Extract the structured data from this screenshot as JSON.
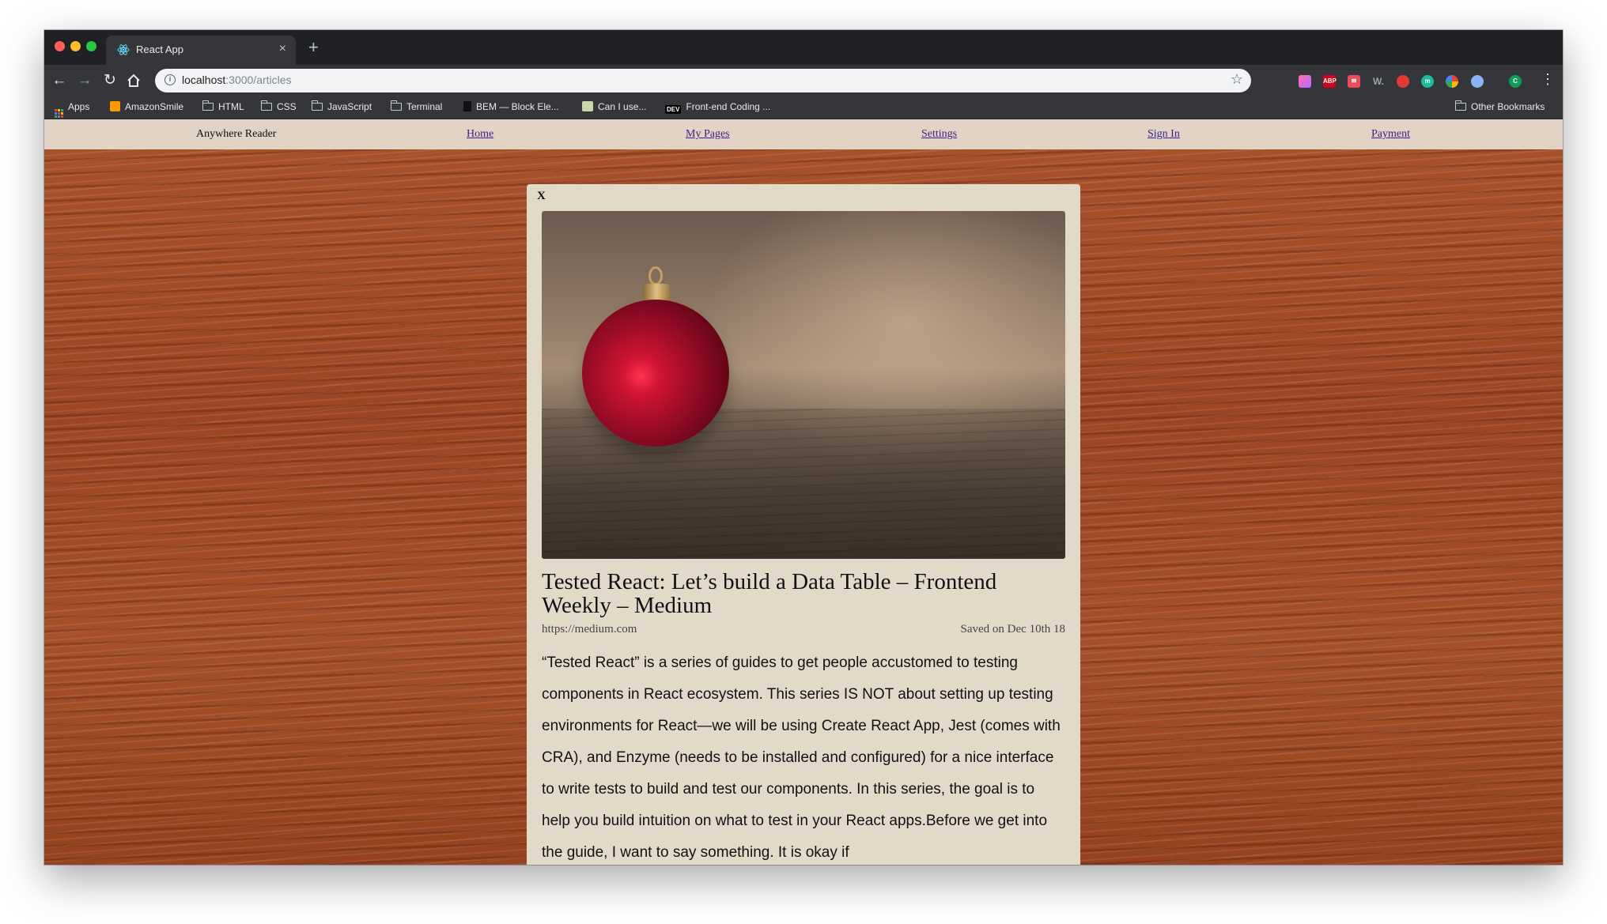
{
  "browser": {
    "tab_title": "React App",
    "tab_close": "×",
    "new_tab": "+",
    "url_host": "localhost",
    "url_path": ":3000/articles",
    "bookmarks": {
      "apps": "Apps",
      "amazonsmile": "AmazonSmile",
      "html": "HTML",
      "css": "CSS",
      "javascript": "JavaScript",
      "terminal": "Terminal",
      "bem": "BEM — Block Ele...",
      "caniuse": "Can I use...",
      "dev": "Front-end Coding ...",
      "other": "Other Bookmarks"
    },
    "extensions": [
      "ABP",
      "W."
    ]
  },
  "site_nav": {
    "brand": "Anywhere Reader",
    "links": [
      "Home",
      "My Pages",
      "Settings",
      "Sign In",
      "Payment"
    ]
  },
  "article": {
    "close_label": "X",
    "title": "Tested React: Let’s build a Data Table – Frontend Weekly – Medium",
    "source": "https://medium.com",
    "saved": "Saved on Dec 10th 18",
    "body": "“Tested React” is a series of guides to get people accustomed to testing components in React ecosystem. This series IS NOT about setting up testing environments for React—we will be using Create React App, Jest (comes with CRA), and Enzyme (needs to be installed and configured) for a nice interface to write tests to build and test our components. In this series, the goal is to help you build intuition on what to test in your React apps.Before we get into the guide, I want to say something. It is okay if"
  }
}
